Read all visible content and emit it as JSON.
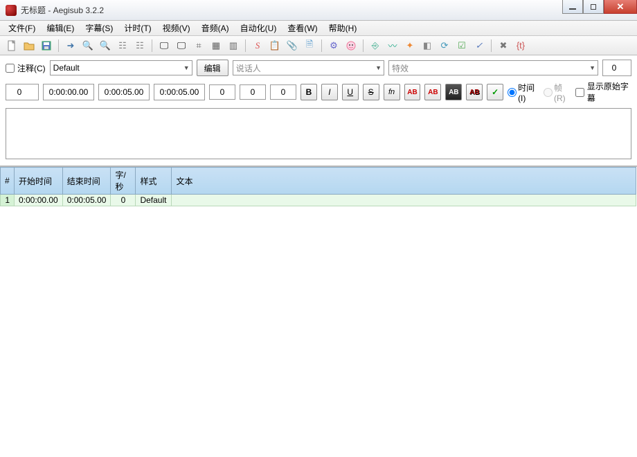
{
  "window": {
    "title": "无标题 - Aegisub 3.2.2"
  },
  "menu": {
    "file": "文件(F)",
    "edit": "编辑(E)",
    "subtitle": "字幕(S)",
    "timing": "计时(T)",
    "video": "视频(V)",
    "audio": "音频(A)",
    "automation": "自动化(U)",
    "view": "查看(W)",
    "help": "帮助(H)"
  },
  "editpanel": {
    "comment_label": "注释(C)",
    "style_value": "Default",
    "edit_btn": "编辑",
    "actor_placeholder": "说话人",
    "effect_placeholder": "特效",
    "layer": "0",
    "margin_l": "0",
    "start": "0:00:00.00",
    "end": "0:00:05.00",
    "duration": "0:00:05.00",
    "margin_1": "0",
    "margin_2": "0",
    "margin_3": "0",
    "fmt_b": "B",
    "fmt_i": "I",
    "fmt_u": "U",
    "fmt_s": "S",
    "fmt_fn": "fn",
    "fmt_ab1": "AB",
    "fmt_ab2": "AB",
    "fmt_ab3": "AB",
    "fmt_ab4": "AB",
    "commit": "✓",
    "time_label": "时间(I)",
    "frame_label": "帧(R)",
    "show_original": "显示原始字幕"
  },
  "grid": {
    "headers": {
      "num": "#",
      "start": "开始时间",
      "end": "结束时间",
      "cps": "字/秒",
      "style": "样式",
      "text": "文本"
    },
    "rows": [
      {
        "num": "1",
        "start": "0:00:00.00",
        "end": "0:00:05.00",
        "cps": "0",
        "style": "Default",
        "text": ""
      }
    ]
  }
}
